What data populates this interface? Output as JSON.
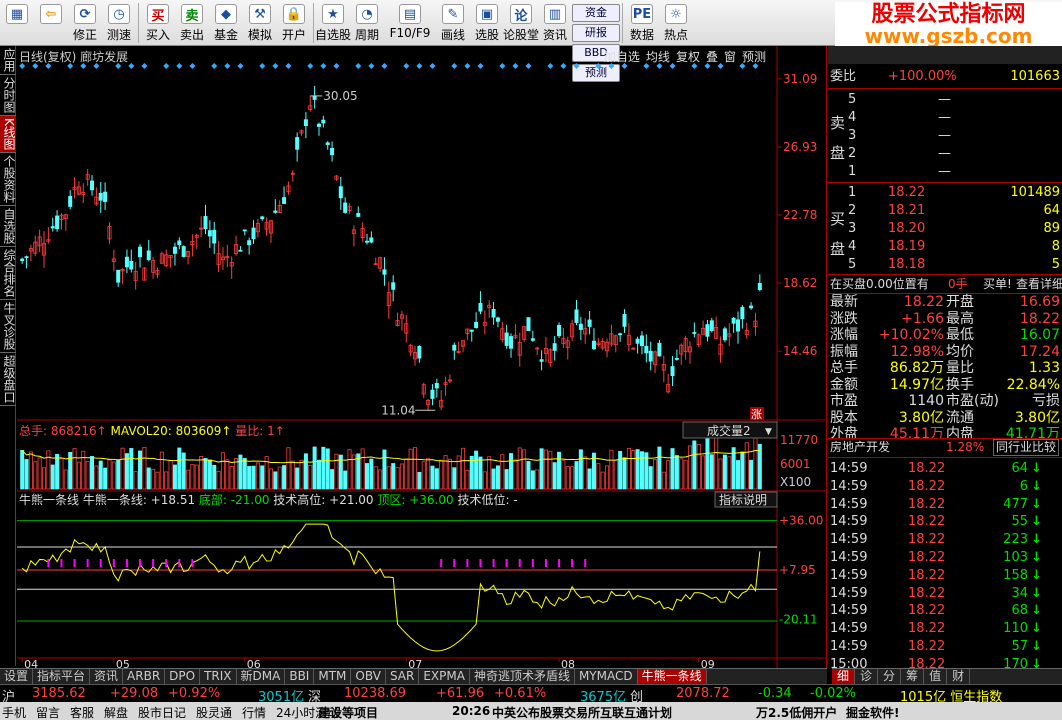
{
  "toolbar": {
    "buttons": [
      {
        "label": "",
        "icon": "grid-icon"
      },
      {
        "label": "",
        "icon": "back-arrow-icon"
      },
      {
        "label": "修正",
        "icon": "refresh-icon"
      },
      {
        "label": "测速",
        "icon": "clock-icon"
      },
      {
        "label": "买入",
        "icon": "buy-icon"
      },
      {
        "label": "卖出",
        "icon": "sell-icon"
      },
      {
        "label": "基金",
        "icon": "fund-icon"
      },
      {
        "label": "模拟",
        "icon": "hammer-icon"
      },
      {
        "label": "开户",
        "icon": "lock-icon"
      },
      {
        "label": "自选股",
        "icon": "star-icon"
      },
      {
        "label": "周期",
        "icon": "period-icon"
      },
      {
        "label": "F10/F9",
        "icon": "f10-icon"
      },
      {
        "label": "画线",
        "icon": "pen-icon"
      },
      {
        "label": "选股",
        "icon": "select-stock-icon"
      },
      {
        "label": "论股堂",
        "icon": "forum-icon"
      },
      {
        "label": "资讯",
        "icon": "news-icon"
      },
      {
        "label": "数据",
        "icon": "data-icon"
      },
      {
        "label": "热点",
        "icon": "hot-icon"
      }
    ],
    "small": [
      "资金",
      "研报",
      "BBD",
      "预测"
    ],
    "watermark1": "股票公式指标网",
    "watermark2": "www.gszb.com"
  },
  "lefttabs": [
    "应用",
    "分时图",
    "K线图",
    "个股资料",
    "自选股",
    "综合排名",
    "牛叉诊股",
    "超级盘口"
  ],
  "chart_header": {
    "title": "日线(复权)  廊坊发展",
    "buttons": [
      "加自选",
      "均线",
      "复权",
      "叠",
      "窗",
      "预测"
    ]
  },
  "volume_header": {
    "total": "总手: 868216",
    "mavol_label": "MAVOL20: 803609",
    "ratio": "量比: 1",
    "selector": "成交量2"
  },
  "indicator_header": {
    "name": "牛熊一条线",
    "l1": "牛熊一条线: +18.51",
    "l2": "底部: -21.00",
    "l3": "技术高位: +21.00",
    "l4": "顶区: +36.00",
    "l5": "技术低位: -",
    "help": "指标说明"
  },
  "price_axis": [
    "31.09",
    "26.93",
    "22.78",
    "18.62",
    "14.46"
  ],
  "peak_label": "30.05",
  "low_label": "11.04",
  "volume_axis": [
    "11770",
    "6001",
    "X100"
  ],
  "indicator_axis": [
    "+36.00",
    "+7.95",
    "-20.11"
  ],
  "zhang_label": "涨",
  "xaxis": [
    {
      "label": "04",
      "idx": 0
    },
    {
      "label": "05",
      "idx": 21
    },
    {
      "label": "06",
      "idx": 51
    },
    {
      "label": "07",
      "idx": 88
    },
    {
      "label": "08",
      "idx": 123
    },
    {
      "label": "09",
      "idx": 155
    }
  ],
  "chart_data": {
    "type": "candlestick",
    "n": 170,
    "ylim": [
      10.5,
      32
    ],
    "peak": {
      "idx": 66,
      "value": 30.05
    },
    "waypoints": [
      [
        0,
        20
      ],
      [
        10,
        23
      ],
      [
        13,
        25
      ],
      [
        18,
        24
      ],
      [
        20,
        22
      ],
      [
        22,
        19
      ],
      [
        25,
        20
      ],
      [
        32,
        20
      ],
      [
        38,
        21
      ],
      [
        42,
        22
      ],
      [
        46,
        20
      ],
      [
        50,
        21
      ],
      [
        55,
        22
      ],
      [
        58,
        23
      ],
      [
        62,
        25
      ],
      [
        66,
        30
      ],
      [
        70,
        27
      ],
      [
        74,
        23
      ],
      [
        78,
        22
      ],
      [
        82,
        20
      ],
      [
        86,
        17
      ],
      [
        90,
        15
      ],
      [
        93,
        12
      ],
      [
        96,
        11.5
      ],
      [
        100,
        15
      ],
      [
        104,
        16
      ],
      [
        108,
        17
      ],
      [
        112,
        15
      ],
      [
        116,
        16
      ],
      [
        120,
        14
      ],
      [
        124,
        15
      ],
      [
        128,
        16
      ],
      [
        132,
        15
      ],
      [
        136,
        16
      ],
      [
        140,
        15
      ],
      [
        144,
        14
      ],
      [
        148,
        13
      ],
      [
        152,
        15
      ],
      [
        156,
        16
      ],
      [
        160,
        15
      ],
      [
        164,
        16
      ],
      [
        169,
        17
      ]
    ],
    "volume_ylim": [
      0,
      11770
    ],
    "mavol20": 803609,
    "indicator": {
      "lines": [
        36,
        21,
        7.95,
        -3,
        -21
      ],
      "ylim": [
        -42,
        42
      ]
    }
  },
  "quote": {
    "weibi_label": "委比",
    "weibi": "+100.00%",
    "weibi_v": "101663",
    "sell_label": "卖盘",
    "sells": [
      {
        "n": "5",
        "p": "—",
        "v": ""
      },
      {
        "n": "4",
        "p": "—",
        "v": ""
      },
      {
        "n": "3",
        "p": "—",
        "v": ""
      },
      {
        "n": "2",
        "p": "—",
        "v": ""
      },
      {
        "n": "1",
        "p": "—",
        "v": ""
      }
    ],
    "buy_label": "买盘",
    "buys": [
      {
        "n": "1",
        "p": "18.22",
        "v": "101489"
      },
      {
        "n": "2",
        "p": "18.21",
        "v": "64"
      },
      {
        "n": "3",
        "p": "18.20",
        "v": "89"
      },
      {
        "n": "4",
        "p": "18.19",
        "v": "8"
      },
      {
        "n": "5",
        "p": "18.18",
        "v": "5"
      }
    ],
    "notice": "在买盘0.00位置有",
    "notice_v": "0手",
    "notice_b": "买单!",
    "notice_c": "查看详细",
    "stats": [
      {
        "l1": "最新",
        "v1": "18.22",
        "l2": "开盘",
        "v2": "16.69"
      },
      {
        "l1": "涨跌",
        "v1": "+1.66",
        "l2": "最高",
        "v2": "18.22"
      },
      {
        "l1": "涨幅",
        "v1": "+10.02%",
        "l2": "最低",
        "v2": "16.07"
      },
      {
        "l1": "振幅",
        "v1": "12.98%",
        "l2": "均价",
        "v2": "17.24"
      },
      {
        "l1": "总手",
        "v1": "86.82万",
        "l2": "量比",
        "v2": "1.33"
      },
      {
        "l1": "金额",
        "v1": "14.97亿",
        "l2": "换手",
        "v2": "22.84%"
      },
      {
        "l1": "市盈",
        "v1": "1140",
        "l2": "市盈(动)",
        "v2": "亏损"
      },
      {
        "l1": "股本",
        "v1": "3.80亿",
        "l2": "流通",
        "v2": "3.80亿"
      },
      {
        "l1": "外盘",
        "v1": "45.11万",
        "l2": "内盘",
        "v2": "41.71万"
      }
    ],
    "sector": "房地产开发",
    "sector_pct": "1.28%",
    "sector_btn": "同行业比较",
    "ticks": [
      {
        "t": "14:59",
        "p": "18.22",
        "v": "64"
      },
      {
        "t": "14:59",
        "p": "18.22",
        "v": "6"
      },
      {
        "t": "14:59",
        "p": "18.22",
        "v": "477"
      },
      {
        "t": "14:59",
        "p": "18.22",
        "v": "55"
      },
      {
        "t": "14:59",
        "p": "18.22",
        "v": "223"
      },
      {
        "t": "14:59",
        "p": "18.22",
        "v": "103"
      },
      {
        "t": "14:59",
        "p": "18.22",
        "v": "158"
      },
      {
        "t": "14:59",
        "p": "18.22",
        "v": "34"
      },
      {
        "t": "14:59",
        "p": "18.22",
        "v": "68"
      },
      {
        "t": "14:59",
        "p": "18.22",
        "v": "110"
      },
      {
        "t": "14:59",
        "p": "18.22",
        "v": "57"
      },
      {
        "t": "15:00",
        "p": "18.22",
        "v": "170"
      }
    ],
    "rtabs": [
      "细",
      "诊",
      "分",
      "筹",
      "值",
      "财"
    ]
  },
  "bottom_tabs": [
    "设置",
    "指标平台",
    "资讯",
    "ARBR",
    "DPO",
    "TRIX",
    "新DMA",
    "BBI",
    "MTM",
    "OBV",
    "SAR",
    "EXPMA",
    "神奇逃顶术矛盾线",
    "MYMACD",
    "牛熊一条线"
  ],
  "status1": {
    "sh_label": "沪",
    "sh": "3185.62",
    "sh_chg": "+29.08",
    "sh_pct": "+0.92%",
    "sh_amt": "3051亿",
    "sz_label": "深",
    "sz": "10238.69",
    "sz_chg": "+61.96",
    "sz_pct": "+0.61%",
    "sz_amt": "3675亿",
    "cy_label": "创",
    "cy": "2078.72",
    "cy_chg": "-0.34",
    "cy_pct": "-0.02%",
    "tail": "1015亿 恒生指数"
  },
  "status2": {
    "items": [
      "手机",
      "留言",
      "客服",
      "解盘",
      "股市日记",
      "股灵通",
      "行情",
      "24小时滚动"
    ],
    "news1": "建设等项目",
    "time": "20:26",
    "news2": "中英公布股票交易所互联互通计划",
    "news3": "万2.5低佣开户",
    "news4": "掘金软件!"
  }
}
